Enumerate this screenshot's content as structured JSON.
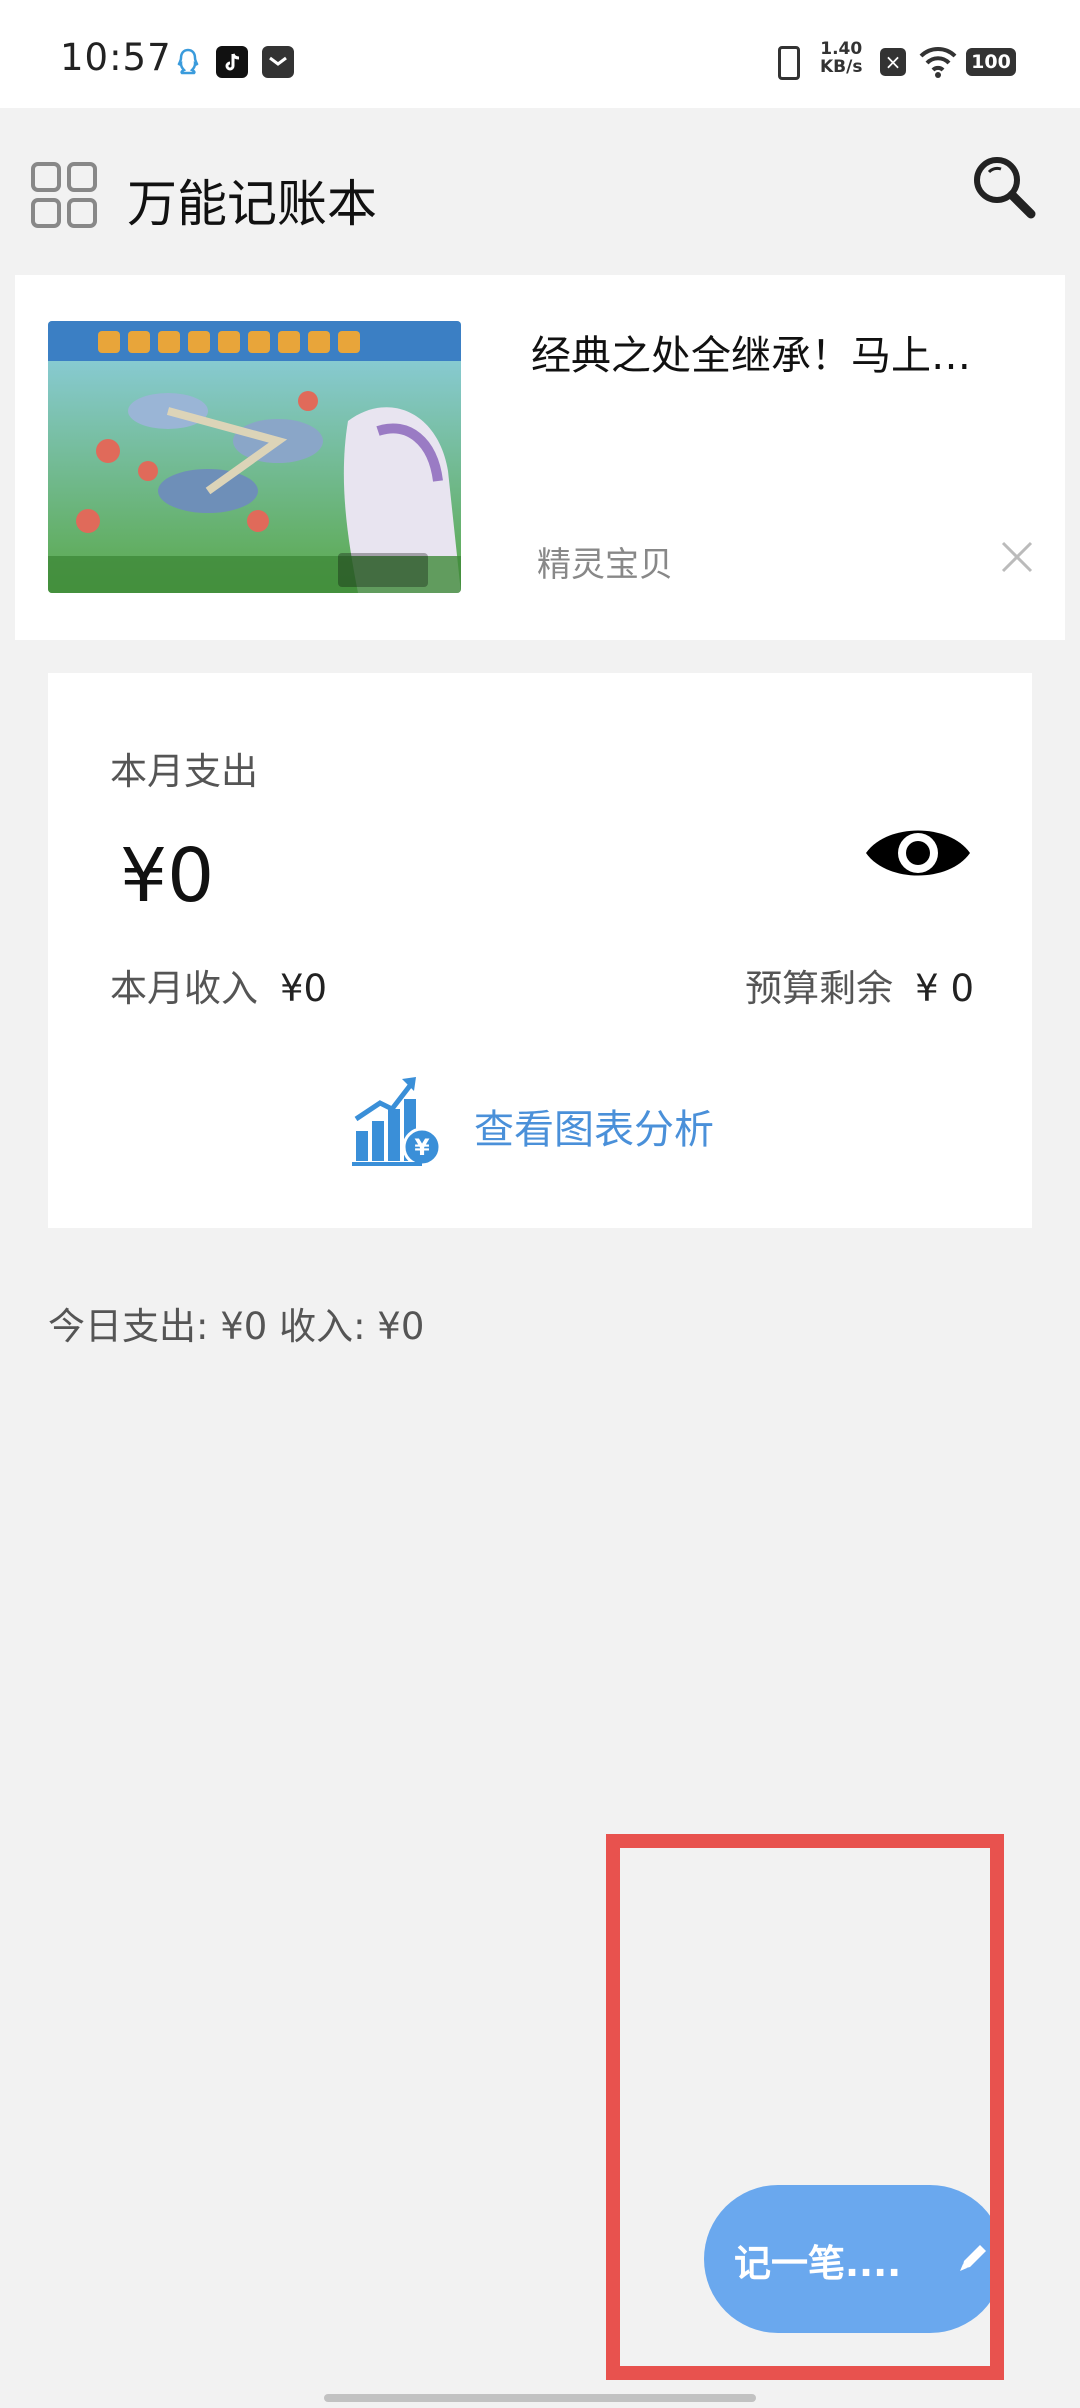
{
  "status_bar": {
    "time": "10:57",
    "net_speed_value": "1.40",
    "net_speed_unit": "KB/s",
    "battery": "100"
  },
  "header": {
    "title": "万能记账本"
  },
  "ad": {
    "title": "经典之处全继承！马上…",
    "source": "精灵宝贝"
  },
  "summary": {
    "month_expense_label": "本月支出",
    "month_expense_value": "¥0",
    "month_income_label": "本月收入",
    "month_income_value": "¥0",
    "budget_label": "预算剩余",
    "budget_value": "¥ 0",
    "chart_link_label": "查看图表分析"
  },
  "today": {
    "text": "今日支出: ¥0 收入: ¥0"
  },
  "fab": {
    "label": "记一笔...."
  },
  "colors": {
    "accent_blue": "#4a90d9",
    "fab_blue": "#6aa8ee",
    "highlight_red": "#e8524e",
    "background": "#f2f2f2"
  }
}
